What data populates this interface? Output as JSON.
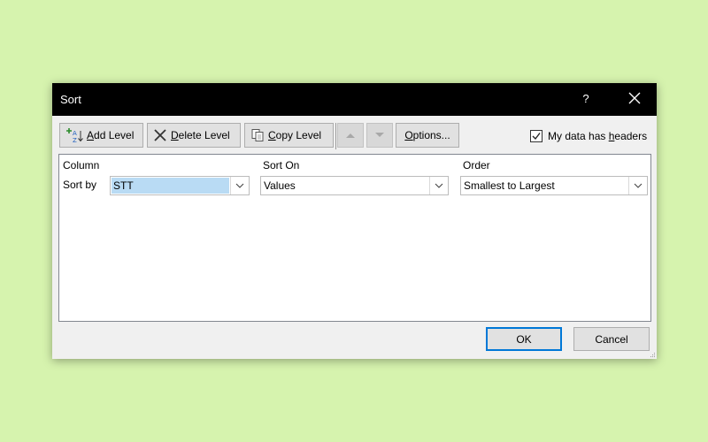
{
  "dialog": {
    "title": "Sort",
    "help_label": "?",
    "close_icon": "close-icon"
  },
  "toolbar": {
    "add_level": {
      "accel": "A",
      "rest": "dd Level",
      "icon": "add-level-icon"
    },
    "delete_level": {
      "accel": "D",
      "rest": "elete Level",
      "icon": "delete-icon"
    },
    "copy_level": {
      "accel": "C",
      "rest": "opy Level",
      "icon": "copy-icon"
    },
    "move_up_icon": "triangle-up-icon",
    "move_down_icon": "triangle-down-icon",
    "options": {
      "accel": "O",
      "rest": "ptions..."
    },
    "headers_checkbox": {
      "checked": true,
      "label_pre": "My data has ",
      "accel": "h",
      "label_post": "eaders"
    }
  },
  "grid": {
    "columns": [
      "Column",
      "Sort On",
      "Order"
    ],
    "rows": [
      {
        "label": "Sort by",
        "column": "STT",
        "sort_on": "Values",
        "order": "Smallest to Largest"
      }
    ]
  },
  "buttons": {
    "ok": "OK",
    "cancel": "Cancel"
  },
  "colors": {
    "background": "#d6f3ae",
    "titlebar": "#000000",
    "selection": "#b9dbf4",
    "accent": "#0078d7"
  }
}
